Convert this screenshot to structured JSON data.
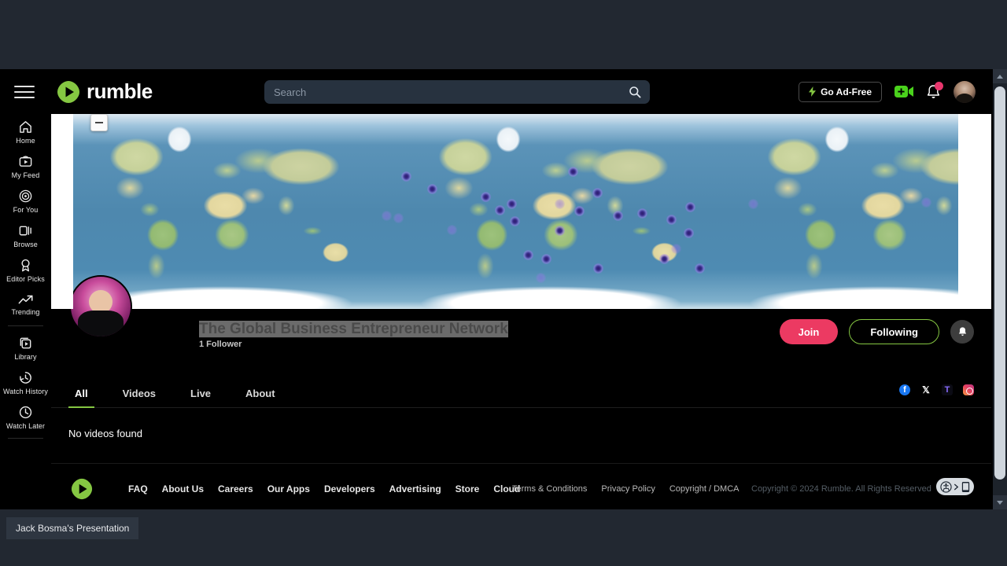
{
  "header": {
    "logo_text": "rumble",
    "menu_icon": "hamburger-icon",
    "search": {
      "placeholder": "Search",
      "value": ""
    },
    "ad_free_label": "Go Ad-Free",
    "upload_icon": "video-plus-icon",
    "bell_icon": "notification-bell-icon",
    "avatar_label": "user-avatar"
  },
  "sidebar": {
    "items": [
      {
        "label": "Home",
        "icon": "home-icon"
      },
      {
        "label": "My Feed",
        "icon": "feed-icon"
      },
      {
        "label": "For You",
        "icon": "target-icon"
      },
      {
        "label": "Browse",
        "icon": "browse-icon"
      },
      {
        "label": "Editor Picks",
        "icon": "award-icon"
      },
      {
        "label": "Trending",
        "icon": "trending-up-icon"
      },
      {
        "label": "Library",
        "icon": "library-icon"
      },
      {
        "label": "Watch History",
        "icon": "history-icon"
      },
      {
        "label": "Watch Later",
        "icon": "clock-icon"
      }
    ]
  },
  "banner": {
    "type": "world-map",
    "zoom_out_label": "−",
    "marker_count": 28
  },
  "channel": {
    "title": "The Global Business Entrepreneur Network",
    "followers": "1 Follower",
    "join_label": "Join",
    "following_label": "Following",
    "bell_icon": "notification-bell-icon"
  },
  "tabs": [
    {
      "label": "All",
      "active": true
    },
    {
      "label": "Videos",
      "active": false
    },
    {
      "label": "Live",
      "active": false
    },
    {
      "label": "About",
      "active": false
    }
  ],
  "socials": [
    {
      "name": "facebook",
      "glyph": "f"
    },
    {
      "name": "x-twitter",
      "glyph": "𝕏"
    },
    {
      "name": "truth-social",
      "glyph": "T"
    },
    {
      "name": "instagram",
      "glyph": ""
    }
  ],
  "content": {
    "empty_message": "No videos found"
  },
  "footer": {
    "links": [
      "FAQ",
      "About Us",
      "Careers",
      "Our Apps",
      "Developers",
      "Advertising",
      "Store",
      "Cloud"
    ],
    "legal": [
      "Terms & Conditions",
      "Privacy Policy",
      "Copyright / DMCA"
    ],
    "copyright": "Copyright © 2024 Rumble. All Rights Reserved",
    "accessibility_icon": "accessibility-widget-icon"
  },
  "taskbar": {
    "window_title": "Jack Bosma's Presentation"
  },
  "colors": {
    "page_background": "#222831",
    "app_background": "#000000",
    "accent_green": "#85c742",
    "join_pink": "#ec3a62",
    "search_background": "#27323f",
    "notification_dot": "#e8366d"
  }
}
